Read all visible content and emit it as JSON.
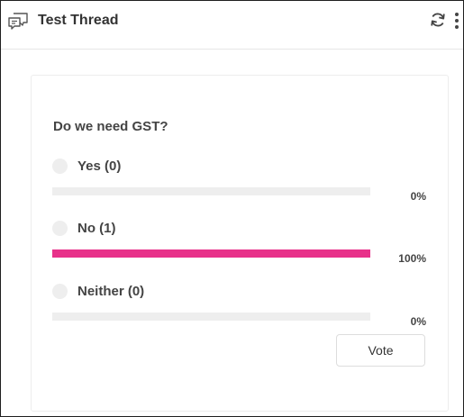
{
  "header": {
    "title": "Test Thread",
    "left_icon": "chat-bubbles-icon",
    "right_icons": [
      "refresh-icon",
      "more-vertical-icon"
    ]
  },
  "poll": {
    "question": "Do we need GST?",
    "options": [
      {
        "label": "Yes (0)",
        "percent_label": "0%",
        "percent": 0
      },
      {
        "label": "No (1)",
        "percent_label": "100%",
        "percent": 100
      },
      {
        "label": "Neither (0)",
        "percent_label": "0%",
        "percent": 0
      }
    ],
    "vote_label": "Vote",
    "bar_fill_color": "#e8318a",
    "bar_track_color": "#eeeeee"
  }
}
